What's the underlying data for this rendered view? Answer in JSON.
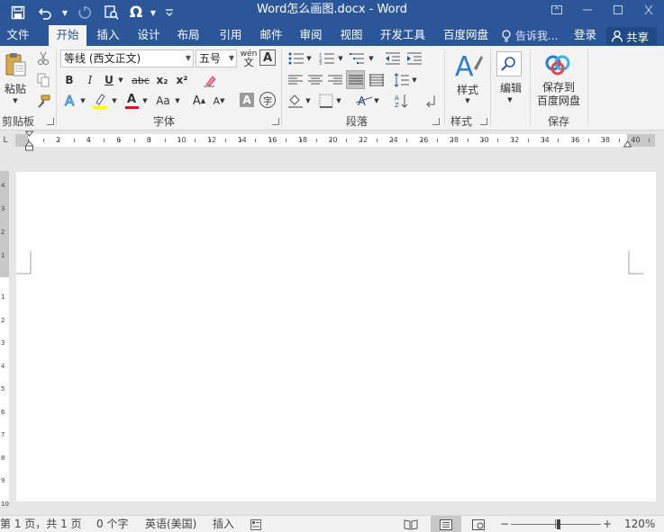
{
  "window": {
    "title": "Word怎么画图.docx - Word"
  },
  "quick_access": {
    "items": [
      "save-icon",
      "undo-icon",
      "redo-icon",
      "print-preview-icon",
      "symbol-omega-icon",
      "customize-icon"
    ],
    "omega": "Ω"
  },
  "tabs": {
    "file": "文件",
    "home": "开始",
    "insert": "插入",
    "design": "设计",
    "layout": "布局",
    "references": "引用",
    "mailings": "邮件",
    "review": "审阅",
    "view": "视图",
    "developer": "开发工具",
    "baidu": "百度网盘",
    "active": "开始"
  },
  "tell_me": "告诉我...",
  "login": "登录",
  "share": "共享",
  "clipboard": {
    "paste": "粘贴",
    "group": "剪贴板"
  },
  "font": {
    "name": "等线 (西文正文)",
    "size": "五号",
    "bold": "B",
    "italic": "I",
    "underline": "U",
    "strike": "abc",
    "subscript": "x₂",
    "superscript": "x²",
    "phonetic": "wén",
    "border_char": "A",
    "font_color": "A",
    "case": "Aa",
    "grow": "A",
    "shrink": "A",
    "shade": "A",
    "enclose": "字",
    "group": "字体"
  },
  "paragraph": {
    "group": "段落"
  },
  "styles": {
    "label": "样式",
    "group": "样式"
  },
  "editing": {
    "label": "编辑"
  },
  "save": {
    "label_line1": "保存到",
    "label_line2": "百度网盘",
    "group": "保存"
  },
  "ruler": {
    "numbers": [
      "2",
      "4",
      "6",
      "8",
      "10",
      "12",
      "14",
      "16",
      "18",
      "20",
      "22",
      "24",
      "26",
      "28",
      "30",
      "32",
      "34",
      "36",
      "38",
      "40"
    ],
    "vertical_numbers": [
      "4",
      "3",
      "2",
      "1",
      "1",
      "2",
      "3",
      "4",
      "5",
      "6",
      "7",
      "8",
      "9",
      "10"
    ]
  },
  "status": {
    "page": "第 1 页，共 1 页",
    "words": "0 个字",
    "language": "英语(美国)",
    "mode": "插入",
    "zoom": "120%",
    "zoom_minus": "−",
    "zoom_plus": "+"
  },
  "colors": {
    "accent": "#2b579a",
    "ribbon_bg": "#f3f3f3",
    "highlight": "#ffff00",
    "font_red": "#e81123"
  }
}
